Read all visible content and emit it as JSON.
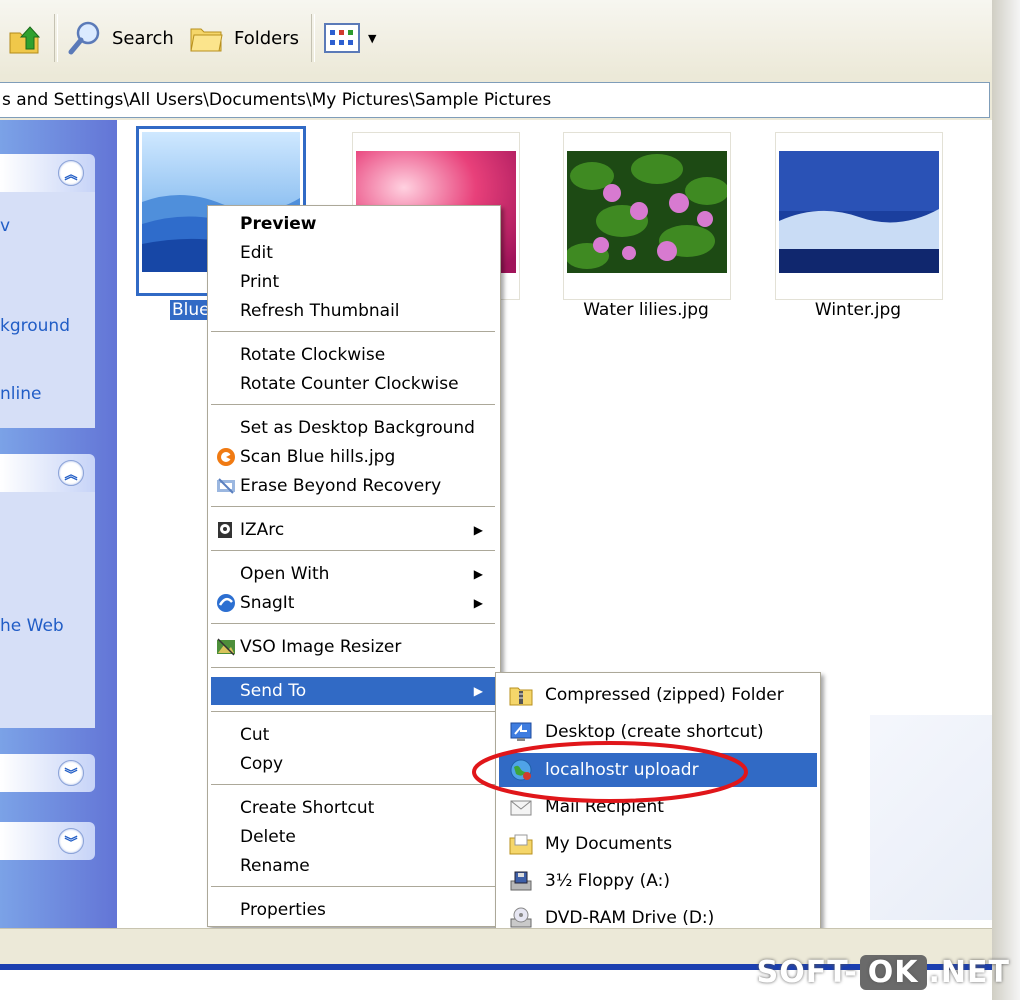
{
  "toolbar": {
    "search_label": "Search",
    "folders_label": "Folders"
  },
  "address": {
    "path": "s and Settings\\All Users\\Documents\\My Pictures\\Sample Pictures"
  },
  "taskpane": {
    "fragments": [
      "v",
      "kground",
      "nline",
      "he Web"
    ]
  },
  "files": [
    {
      "name": "Blue",
      "selected": true
    },
    {
      "name": "",
      "selected": false
    },
    {
      "name": "Water lilies.jpg",
      "selected": false
    },
    {
      "name": "Winter.jpg",
      "selected": false
    }
  ],
  "context_menu": {
    "items": [
      {
        "label": "Preview",
        "bold": true
      },
      {
        "label": "Edit"
      },
      {
        "label": "Print"
      },
      {
        "label": "Refresh Thumbnail"
      },
      {
        "label": "Rotate Clockwise"
      },
      {
        "label": "Rotate Counter Clockwise"
      },
      {
        "label": "Set as Desktop Background"
      },
      {
        "label": "Scan Blue hills.jpg",
        "icon": "scan-icon"
      },
      {
        "label": "Erase Beyond Recovery",
        "icon": "erase-icon"
      },
      {
        "label": "IZArc",
        "icon": "izarc-icon",
        "submenu": true
      },
      {
        "label": "Open With",
        "submenu": true
      },
      {
        "label": "SnagIt",
        "icon": "snagit-icon",
        "submenu": true
      },
      {
        "label": "VSO Image Resizer",
        "icon": "vso-icon"
      },
      {
        "label": "Send To",
        "submenu": true,
        "highlighted": true
      },
      {
        "label": "Cut"
      },
      {
        "label": "Copy"
      },
      {
        "label": "Create Shortcut"
      },
      {
        "label": "Delete"
      },
      {
        "label": "Rename"
      },
      {
        "label": "Properties"
      }
    ]
  },
  "send_to": {
    "items": [
      {
        "label": "Compressed (zipped) Folder",
        "icon": "zip-folder-icon"
      },
      {
        "label": "Desktop (create shortcut)",
        "icon": "desktop-icon"
      },
      {
        "label": "localhostr uploadr",
        "icon": "globe-icon",
        "highlighted": true
      },
      {
        "label": "Mail Recipient",
        "icon": "mail-icon"
      },
      {
        "label": "My Documents",
        "icon": "my-documents-icon"
      },
      {
        "label": "3½ Floppy (A:)",
        "icon": "floppy-icon"
      },
      {
        "label": "DVD-RAM Drive (D:)",
        "icon": "dvd-icon"
      }
    ]
  },
  "watermark": {
    "left": "SOFT-",
    "mid": "OK",
    "right": ".NET"
  },
  "colors": {
    "highlight": "#316ac5",
    "annotation_circle": "#e0161a",
    "taskpane": "#7ba2e7"
  }
}
